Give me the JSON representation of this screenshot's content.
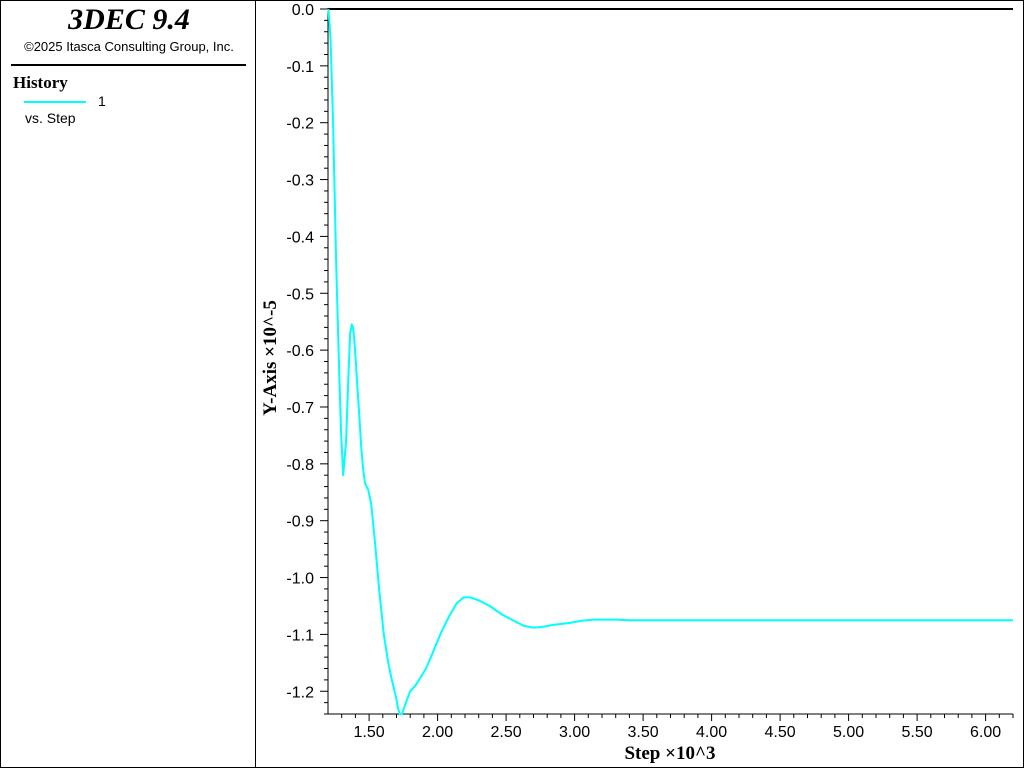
{
  "legend": {
    "app_title": "3DEC 9.4",
    "copyright": "©2025 Itasca Consulting Group, Inc.",
    "history_title": "History",
    "series_label": "1",
    "vs_label": "vs. Step"
  },
  "colors": {
    "series": "#00ffff",
    "axis": "#000000",
    "background": "#ffffff"
  },
  "chart_data": {
    "type": "line",
    "xlabel": "Step ×10^3",
    "ylabel": "Y-Axis ×10^-5",
    "xlim": [
      1.2,
      6.2
    ],
    "ylim": [
      -1.24,
      0.0
    ],
    "x_ticks": [
      1.5,
      2.0,
      2.5,
      3.0,
      3.5,
      4.0,
      4.5,
      5.0,
      5.5,
      6.0
    ],
    "x_tick_labels": [
      "1.50",
      "2.00",
      "2.50",
      "3.00",
      "3.50",
      "4.00",
      "4.50",
      "5.00",
      "5.50",
      "6.00"
    ],
    "y_ticks": [
      0.0,
      -0.1,
      -0.2,
      -0.3,
      -0.4,
      -0.5,
      -0.6,
      -0.7,
      -0.8,
      -0.9,
      -1.0,
      -1.1,
      -1.2
    ],
    "y_tick_labels": [
      "0.0",
      "-0.1",
      "-0.2",
      "-0.3",
      "-0.4",
      "-0.5",
      "-0.6",
      "-0.7",
      "-0.8",
      "-0.9",
      "-1.0",
      "-1.1",
      "-1.2"
    ],
    "grid": false,
    "series": [
      {
        "name": "1",
        "x": [
          1.203,
          1.218,
          1.237,
          1.26,
          1.283,
          1.296,
          1.311,
          1.332,
          1.348,
          1.362,
          1.373,
          1.384,
          1.398,
          1.413,
          1.43,
          1.442,
          1.457,
          1.471,
          1.493,
          1.515,
          1.544,
          1.573,
          1.607,
          1.64,
          1.666,
          1.696,
          1.711,
          1.725,
          1.74,
          1.755,
          1.776,
          1.8,
          1.838,
          1.878,
          1.915,
          1.96,
          2.02,
          2.08,
          2.14,
          2.19,
          2.24,
          2.3,
          2.38,
          2.47,
          2.55,
          2.63,
          2.7,
          2.76,
          2.85,
          2.96,
          3.05,
          3.14,
          3.2,
          3.3,
          3.4,
          3.5,
          3.6,
          3.8,
          4.0,
          4.5,
          5.0,
          5.5,
          6.0,
          6.2
        ],
        "y": [
          0.0,
          -0.05,
          -0.2,
          -0.45,
          -0.65,
          -0.75,
          -0.82,
          -0.76,
          -0.65,
          -0.57,
          -0.555,
          -0.56,
          -0.6,
          -0.66,
          -0.72,
          -0.77,
          -0.81,
          -0.835,
          -0.845,
          -0.87,
          -0.94,
          -1.02,
          -1.1,
          -1.15,
          -1.18,
          -1.21,
          -1.23,
          -1.24,
          -1.24,
          -1.23,
          -1.215,
          -1.2,
          -1.19,
          -1.175,
          -1.16,
          -1.135,
          -1.1,
          -1.07,
          -1.045,
          -1.035,
          -1.035,
          -1.04,
          -1.05,
          -1.065,
          -1.075,
          -1.085,
          -1.088,
          -1.087,
          -1.083,
          -1.08,
          -1.076,
          -1.074,
          -1.074,
          -1.074,
          -1.075,
          -1.075,
          -1.075,
          -1.075,
          -1.075,
          -1.075,
          -1.075,
          -1.075,
          -1.075,
          -1.075
        ]
      }
    ]
  }
}
